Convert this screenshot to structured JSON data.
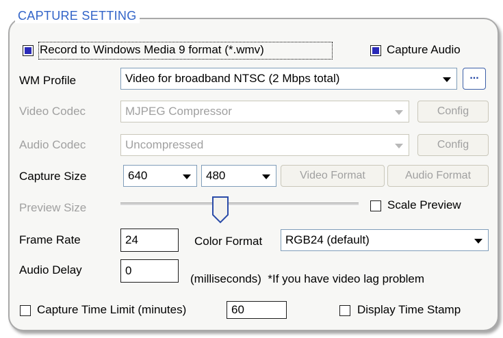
{
  "title": "CAPTURE SETTING",
  "record_wmv": {
    "label": "Record to Windows Media 9 format (*.wmv)",
    "checked": true
  },
  "capture_audio": {
    "label": "Capture Audio",
    "checked": true
  },
  "wm_profile": {
    "label": "WM Profile",
    "value": "Video for broadband NTSC (2 Mbps total)",
    "browse_label": "..."
  },
  "video_codec": {
    "label": "Video Codec",
    "value": "MJPEG Compressor",
    "config_label": "Config",
    "enabled": false
  },
  "audio_codec": {
    "label": "Audio Codec",
    "value": "Uncompressed",
    "config_label": "Config",
    "enabled": false
  },
  "capture_size": {
    "label": "Capture Size",
    "width": "640",
    "height": "480",
    "video_format_label": "Video Format",
    "audio_format_label": "Audio Format"
  },
  "preview_size": {
    "label": "Preview Size",
    "enabled": false,
    "scale_preview_label": "Scale Preview",
    "scale_preview_checked": false,
    "level": 0.42
  },
  "frame_rate": {
    "label": "Frame Rate",
    "value": "24"
  },
  "color_format": {
    "label": "Color Format",
    "value": "RGB24 (default)"
  },
  "audio_delay": {
    "label": "Audio Delay",
    "value": "0",
    "note": "(milliseconds)  *If you have video lag problem"
  },
  "time_limit": {
    "label": "Capture Time Limit (minutes)",
    "value": "60",
    "checked": false
  },
  "display_time_stamp": {
    "label": "Display Time Stamp",
    "checked": false
  },
  "colors": {
    "accent": "#3264c8",
    "check_fill": "#2a2ab8",
    "disabled_text": "#a0a0a0"
  }
}
